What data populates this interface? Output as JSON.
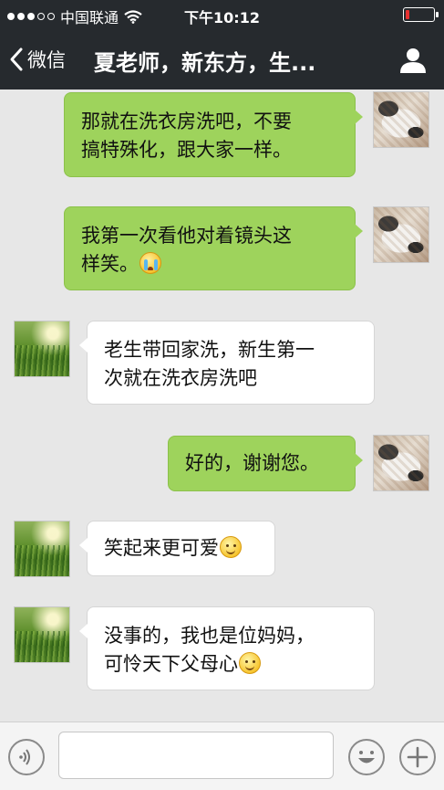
{
  "status_bar": {
    "carrier": "中国联通",
    "time": "下午10:12",
    "signal_dots_filled": 3,
    "signal_dots_total": 5,
    "battery_level_percent": 15,
    "battery_color": "#e53030"
  },
  "nav": {
    "back_label": "微信",
    "title": "夏老师，新东方，生..."
  },
  "messages": [
    {
      "direction": "outgoing",
      "lines": [
        "那就在洗衣房洗吧，不要",
        "搞特殊化，跟大家一样。"
      ],
      "avatar": "cat"
    },
    {
      "direction": "outgoing",
      "lines": [
        "我第一次看他对着镜头这",
        "样笑。"
      ],
      "trailing_emoji": "crying-emoji",
      "avatar": "cat"
    },
    {
      "direction": "incoming",
      "lines": [
        "老生带回家洗，新生第一",
        "次就在洗衣房洗吧"
      ],
      "avatar": "grass"
    },
    {
      "direction": "outgoing",
      "lines": [
        "好的，谢谢您。"
      ],
      "avatar": "cat"
    },
    {
      "direction": "incoming",
      "lines": [
        "笑起来更可爱"
      ],
      "trailing_emoji": "smile-emoji",
      "avatar": "grass"
    },
    {
      "direction": "incoming",
      "lines": [
        "没事的，我也是位妈妈，",
        "可怜天下父母心"
      ],
      "trailing_emoji": "smile-emoji",
      "avatar": "grass"
    }
  ],
  "input_bar": {
    "text_value": "",
    "icons": [
      "voice-icon",
      "emoji-face-icon",
      "plus-icon"
    ]
  },
  "colors": {
    "header_bg": "#262a2e",
    "outgoing_bubble": "#9ed35c",
    "incoming_bubble": "#ffffff",
    "chat_bg": "#e7e7e7"
  }
}
